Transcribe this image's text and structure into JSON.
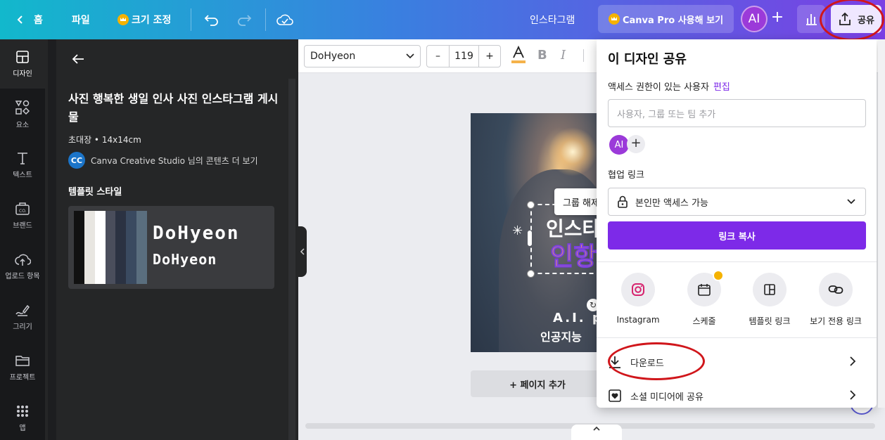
{
  "topbar": {
    "home_label": "홈",
    "file_label": "파일",
    "resize_label": "크기 조정",
    "doc_title": "인스타그램",
    "pro_label": "Canva Pro 사용해 보기",
    "avatar_initials": "AI",
    "share_label": "공유"
  },
  "rail": {
    "items": [
      {
        "label": "디자인",
        "icon": "layout-icon"
      },
      {
        "label": "요소",
        "icon": "shapes-icon"
      },
      {
        "label": "텍스트",
        "icon": "text-icon"
      },
      {
        "label": "브랜드",
        "icon": "brand-icon"
      },
      {
        "label": "업로드 항목",
        "icon": "upload-icon"
      },
      {
        "label": "그리기",
        "icon": "draw-icon"
      },
      {
        "label": "프로젝트",
        "icon": "folder-icon"
      },
      {
        "label": "앱",
        "icon": "apps-icon"
      }
    ]
  },
  "panel": {
    "title": "사진 행복한 생일 인사 사진 인스타그램 게시물",
    "meta": "초대장 • 14x14cm",
    "creator_initials": "CC",
    "creator_text": "Canva Creative Studio 님의 콘텐츠 더 보기",
    "style_heading": "템플릿 스타일",
    "font_preview_1": "DoHyeon",
    "font_preview_2": "DoHyeon",
    "swatches": [
      "#111111",
      "#e8e6e1",
      "#ffffff",
      "#4a4e5c",
      "#2b3242",
      "#3a4a60",
      "#5a6e7e"
    ]
  },
  "editor": {
    "font_name": "DoHyeon",
    "font_size": "119",
    "minus": "–",
    "plus": "+"
  },
  "canvas": {
    "group_tip": "그룹 해제",
    "headline_1": "인스타",
    "headline_2": "인항",
    "sub_1": "A.I. p",
    "sub_2": "인공지능",
    "add_page": "+ 페이지 추가"
  },
  "share": {
    "title": "이 디자인 공유",
    "access_label": "액세스 권한이 있는 사용자",
    "edit_link": "편집",
    "input_placeholder": "사용자, 그룹 또는 팀 추가",
    "avatar_initials": "AI",
    "collab_label": "협업 링크",
    "access_option": "본인만 액세스 가능",
    "copy_link": "링크 복사",
    "options": [
      {
        "label": "Instagram",
        "icon": "instagram-icon"
      },
      {
        "label": "스케줄",
        "icon": "calendar-icon"
      },
      {
        "label": "템플릿 링크",
        "icon": "template-icon"
      },
      {
        "label": "보기 전용 링크",
        "icon": "link-icon"
      }
    ],
    "download_label": "다운로드",
    "social_label": "소셜 미디어에 공유"
  },
  "colors": {
    "accent": "#7d2ae8",
    "highlight_oval": "#d0161b"
  }
}
